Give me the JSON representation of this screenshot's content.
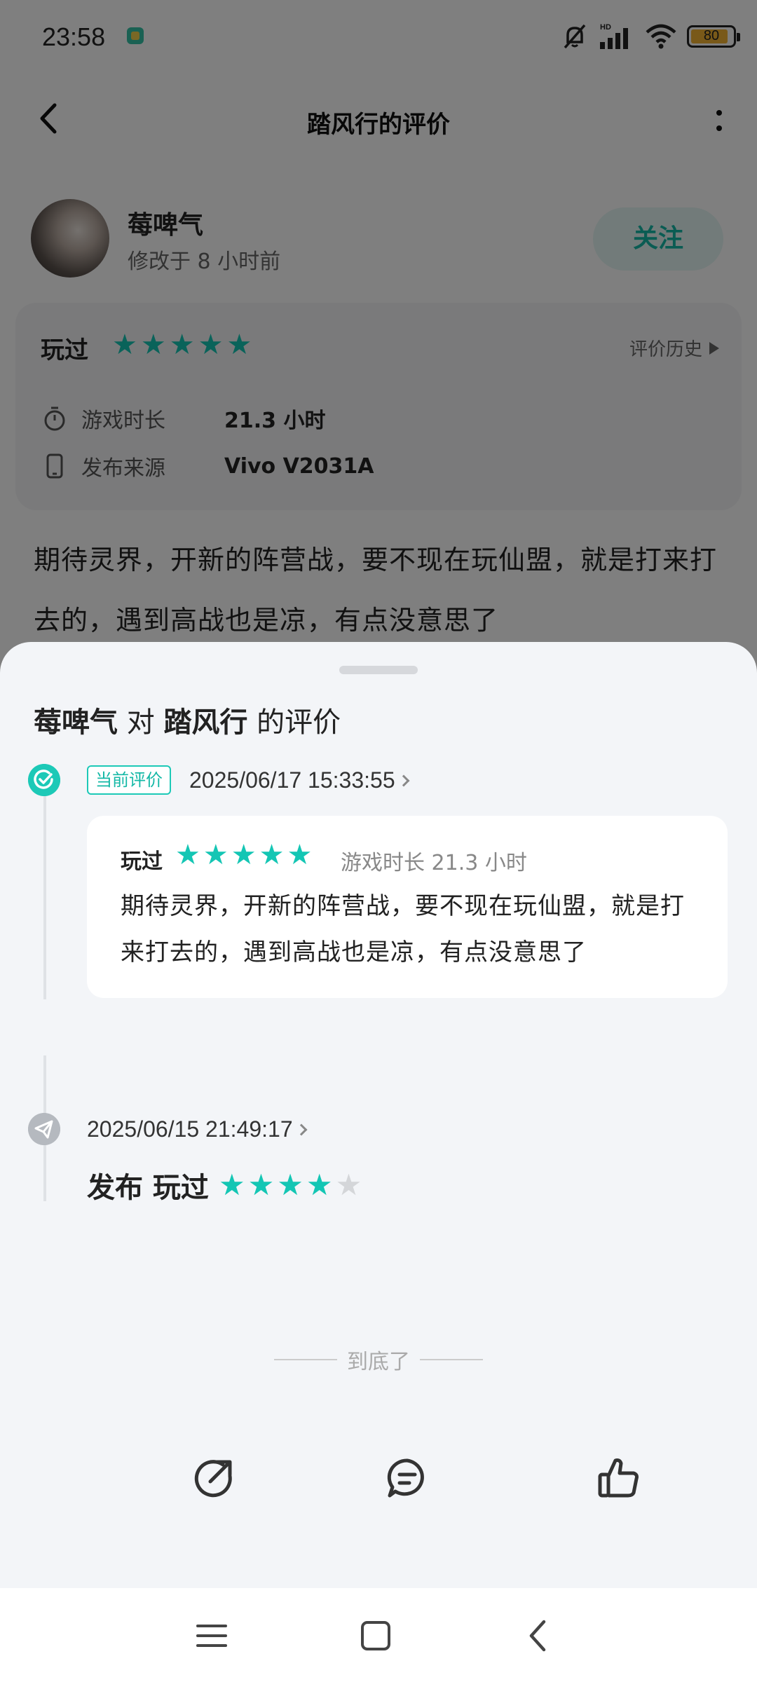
{
  "status_bar": {
    "time": "23:58",
    "battery": "80",
    "battery_level": 0.8,
    "icons": [
      "app-notification-icon",
      "mute-icon",
      "signal-hd-icon",
      "wifi-icon",
      "battery-icon"
    ]
  },
  "header": {
    "title": "踏风行的评价"
  },
  "user": {
    "name": "莓啤气",
    "modified": "修改于 8 小时前",
    "follow_label": "关注"
  },
  "rating_card": {
    "played_label": "玩过",
    "stars": 5,
    "history_label": "评价历史",
    "rows": [
      {
        "icon": "timer-icon",
        "key": "游戏时长",
        "value": "21.3 小时"
      },
      {
        "icon": "phone-icon",
        "key": "发布来源",
        "value": "Vivo V2031A"
      }
    ]
  },
  "review_text": "期待灵界，开新的阵营战，要不现在玩仙盟，就是打来打去的，遇到高战也是凉，有点没意思了",
  "sheet": {
    "title_user": "莓啤气",
    "title_mid": " 对 ",
    "title_game": "踏风行",
    "title_end": " 的评价",
    "current": {
      "badge": "当前评价",
      "date": "2025/06/17 15:33:55",
      "played_label": "玩过",
      "stars": 5,
      "duration": "游戏时长 21.3 小时",
      "text": "期待灵界，开新的阵营战，要不现在玩仙盟，就是打来打去的，遇到高战也是凉，有点没意思了"
    },
    "previous": {
      "date": "2025/06/15 21:49:17",
      "label": "发布 玩过",
      "stars": 4,
      "max_stars": 5
    },
    "end_label": "到底了"
  },
  "colors": {
    "accent": "#14c6b4",
    "star_off": "#d4d6d9",
    "sheet_bg": "#f3f5f8"
  }
}
